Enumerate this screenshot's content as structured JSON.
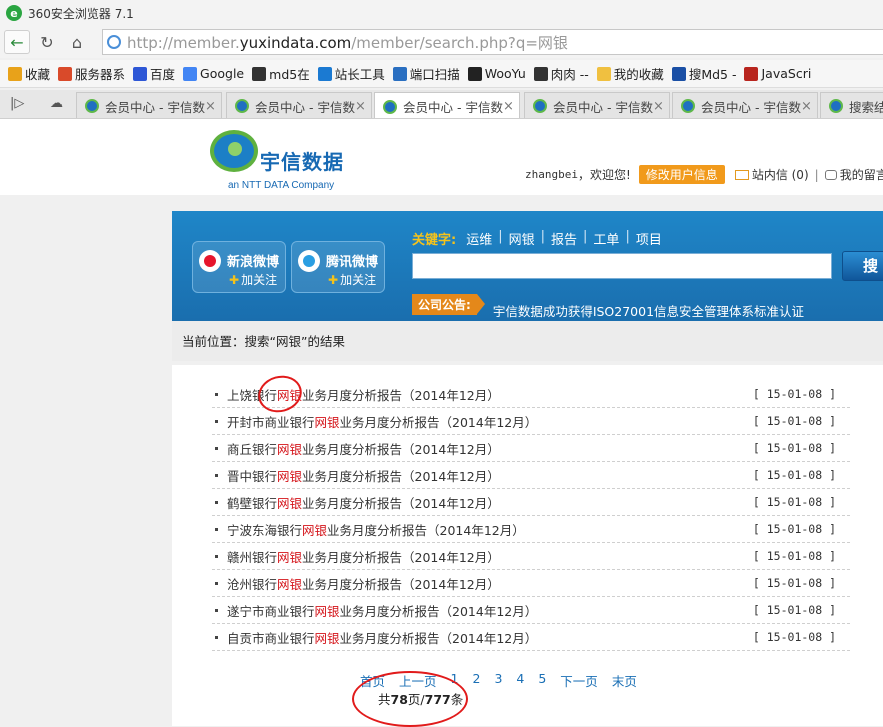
{
  "window": {
    "title": "360安全浏览器 7.1"
  },
  "address": {
    "prefix": "http://member.",
    "domain": "yuxindata.com",
    "path": "/member/search.php?q=网银"
  },
  "bookmarks": [
    {
      "label": "收藏",
      "icon": "star-icon",
      "color": "#e8a21a"
    },
    {
      "label": "服务器系",
      "icon": "puzzle-icon",
      "color": "#d94a2a"
    },
    {
      "label": "百度",
      "icon": "baidu-icon",
      "color": "#2e57d6"
    },
    {
      "label": "Google",
      "icon": "google-icon",
      "color": "#4285f4"
    },
    {
      "label": "md5在",
      "icon": "grid-icon",
      "color": "#333"
    },
    {
      "label": "站长工具",
      "icon": "tools-icon",
      "color": "#1b7ad2"
    },
    {
      "label": "端口扫描",
      "icon": "scan-icon",
      "color": "#2a6fc1"
    },
    {
      "label": "WooYu",
      "icon": "wooyun-icon",
      "color": "#222"
    },
    {
      "label": "肉肉 --",
      "icon": "bug-icon",
      "color": "#333"
    },
    {
      "label": "我的收藏",
      "icon": "folder-icon",
      "color": "#f0c040"
    },
    {
      "label": "搜Md5 -",
      "icon": "md5-icon",
      "color": "#1a4fa5"
    },
    {
      "label": "JavaScri",
      "icon": "w3-icon",
      "color": "#b8251e"
    }
  ],
  "tabs": [
    {
      "label": "会员中心 - 宇信数",
      "active": false
    },
    {
      "label": "会员中心 - 宇信数",
      "active": false
    },
    {
      "label": "会员中心 - 宇信数",
      "active": true
    },
    {
      "label": "会员中心 - 宇信数",
      "active": false
    },
    {
      "label": "会员中心 - 宇信数",
      "active": false
    },
    {
      "label": "搜索结",
      "active": false
    }
  ],
  "brand": {
    "cn": "宇信数据",
    "en": "an NTT DATA Company"
  },
  "user": {
    "name": "zhangbei",
    "welcome": "，欢迎您!",
    "edit": "修改用户信息",
    "mail": "站内信 (0)",
    "sep": "|",
    "msg": "我的留言"
  },
  "weibo": {
    "sina": "新浪微博",
    "tencent": "腾讯微博",
    "follow": "加关注",
    "plus": "✚"
  },
  "keywords": {
    "label": "关键字:",
    "items": [
      "运维",
      "网银",
      "报告",
      "工单",
      "项目"
    ]
  },
  "search": {
    "button": "搜"
  },
  "announce": {
    "label": "公司公告:",
    "text": "宇信数据成功获得ISO27001信息安全管理体系标准认证"
  },
  "crumb": "当前位置：搜索“网银”的结果",
  "results": [
    {
      "pre": "上饶银行",
      "hl": "网银",
      "post": "业务月度分析报告（2014年12月）",
      "date": "[ 15-01-08 ]"
    },
    {
      "pre": "开封市商业银行",
      "hl": "网银",
      "post": "业务月度分析报告（2014年12月）",
      "date": "[ 15-01-08 ]"
    },
    {
      "pre": "商丘银行",
      "hl": "网银",
      "post": "业务月度分析报告（2014年12月）",
      "date": "[ 15-01-08 ]"
    },
    {
      "pre": "晋中银行",
      "hl": "网银",
      "post": "业务月度分析报告（2014年12月）",
      "date": "[ 15-01-08 ]"
    },
    {
      "pre": "鹤壁银行",
      "hl": "网银",
      "post": "业务月度分析报告（2014年12月）",
      "date": "[ 15-01-08 ]"
    },
    {
      "pre": "宁波东海银行",
      "hl": "网银",
      "post": "业务月度分析报告（2014年12月）",
      "date": "[ 15-01-08 ]"
    },
    {
      "pre": "赣州银行",
      "hl": "网银",
      "post": "业务月度分析报告（2014年12月）",
      "date": "[ 15-01-08 ]"
    },
    {
      "pre": "沧州银行",
      "hl": "网银",
      "post": "业务月度分析报告（2014年12月）",
      "date": "[ 15-01-08 ]"
    },
    {
      "pre": "遂宁市商业银行",
      "hl": "网银",
      "post": "业务月度分析报告（2014年12月）",
      "date": "[ 15-01-08 ]"
    },
    {
      "pre": "自贡市商业银行",
      "hl": "网银",
      "post": "业务月度分析报告（2014年12月）",
      "date": "[ 15-01-08 ]"
    }
  ],
  "pager": {
    "first": "首页",
    "prev": "上一页",
    "pages": [
      "1",
      "2",
      "3",
      "4",
      "5"
    ],
    "next": "下一页",
    "last": "末页"
  },
  "total": {
    "pre": "共",
    "pages": "78",
    "mid": "页/",
    "items": "777",
    "post": "条"
  }
}
